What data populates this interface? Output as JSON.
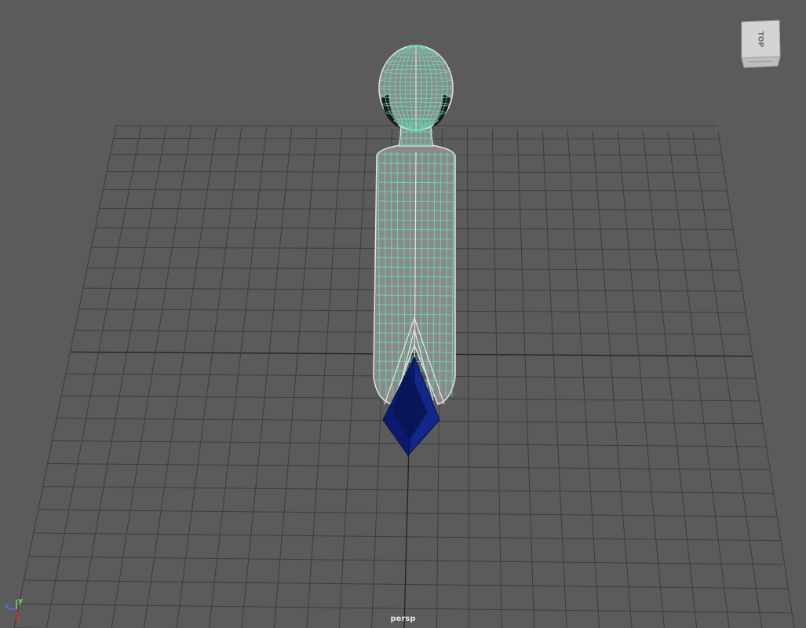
{
  "viewport": {
    "camera_label": "persp",
    "background_color": "#5b5b5b",
    "grid_color": "#3c3c3c",
    "grid_axis_color": "#262626"
  },
  "view_cube": {
    "face_label": "TOP",
    "face_color": "#d4d4d4"
  },
  "axis_indicator": {
    "labels": {
      "x": "x",
      "y": "y",
      "z": "z"
    },
    "colors": {
      "x": "#e03030",
      "y": "#6ee66e",
      "z": "#4a78ff"
    }
  },
  "model": {
    "wireframe_color": "#5ee8b4",
    "highlight_color": "#e6e6e6",
    "surface_color": "#8a8a8a",
    "foot_color": "#0b1a6e"
  }
}
